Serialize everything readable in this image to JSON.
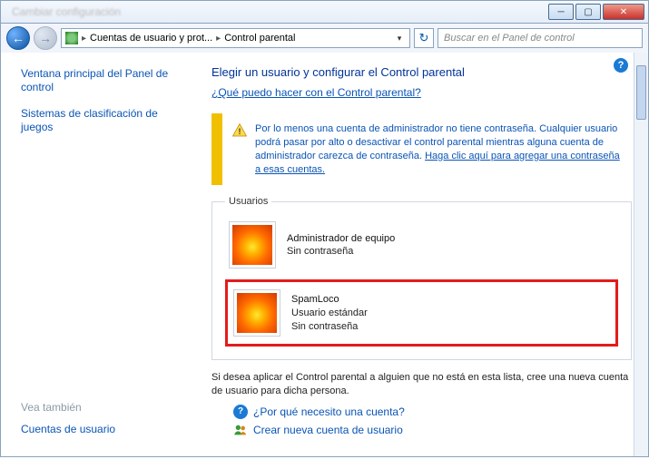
{
  "titlebar": {
    "blurred_title": "Cambiar configuración"
  },
  "nav": {
    "breadcrumb1": "Cuentas de usuario y prot...",
    "breadcrumb2": "Control parental",
    "search_placeholder": "Buscar en el Panel de control"
  },
  "sidebar": {
    "link_main": "Ventana principal del Panel de control",
    "link_ratings": "Sistemas de clasificación de juegos",
    "see_also": "Vea también",
    "link_accounts": "Cuentas de usuario"
  },
  "main": {
    "heading": "Elegir un usuario y configurar el Control parental",
    "sublink": "¿Qué puedo hacer con el Control parental?",
    "warning": {
      "text_pre": "Por lo menos una cuenta de administrador no tiene contraseña. Cualquier usuario podrá pasar por alto o desactivar el control parental mientras alguna cuenta de administrador carezca de contraseña. ",
      "link": "Haga clic aquí para agregar una contraseña a esas cuentas."
    },
    "users_legend": "Usuarios",
    "users": [
      {
        "name": "",
        "role": "Administrador de equipo",
        "pw": "Sin contraseña",
        "highlight": false
      },
      {
        "name": "SpamLoco",
        "role": "Usuario estándar",
        "pw": "Sin contraseña",
        "highlight": true
      }
    ],
    "footer": "Si desea aplicar el Control parental a alguien que no está en esta lista, cree una nueva cuenta de usuario para dicha persona.",
    "why_link": "¿Por qué necesito una cuenta?",
    "create_link": "Crear nueva cuenta de usuario"
  }
}
